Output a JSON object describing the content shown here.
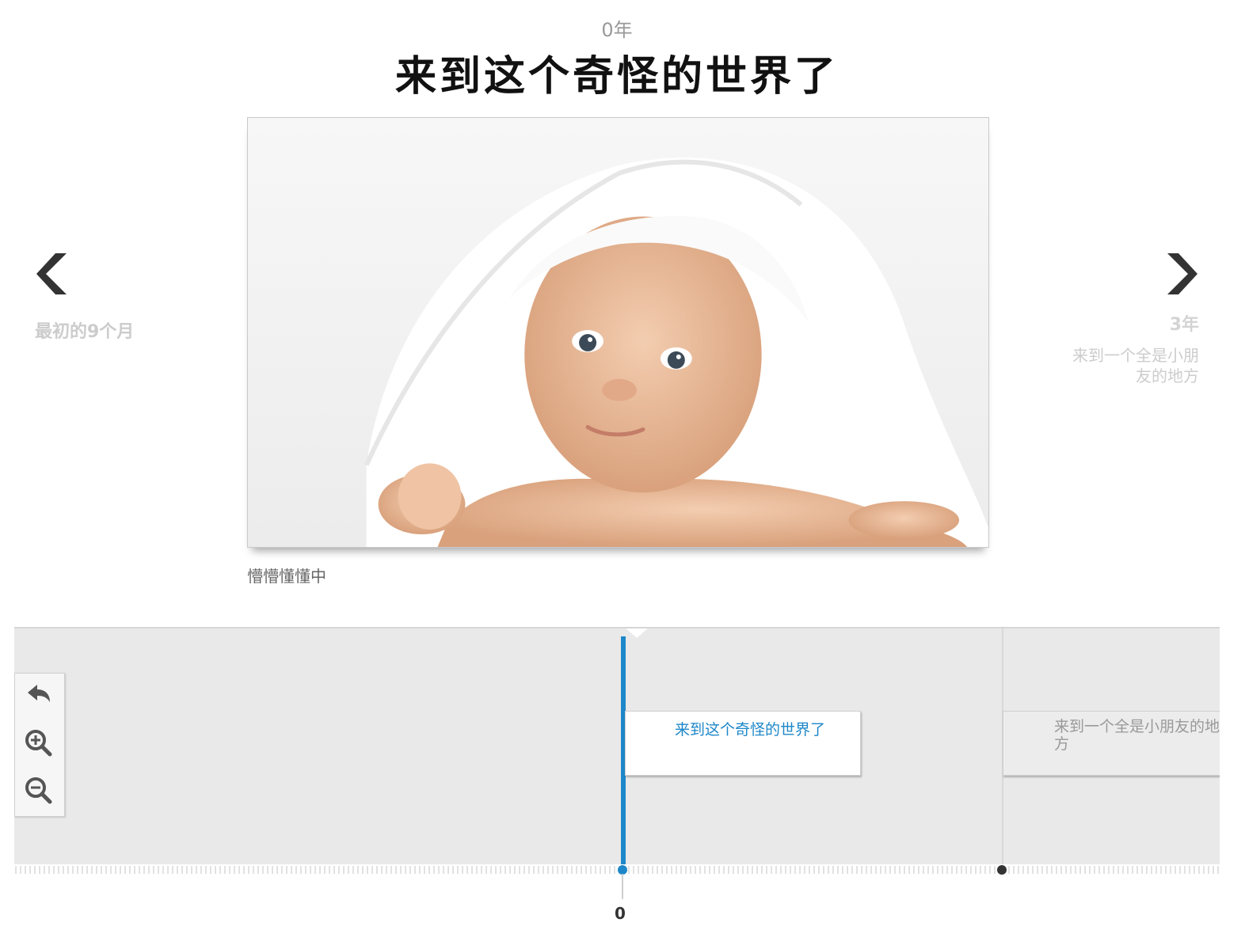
{
  "slide": {
    "year": "0年",
    "title": "来到这个奇怪的世界了",
    "caption": "懵懵懂懂中",
    "media_subject": "baby under white towel photo"
  },
  "nav": {
    "prev": {
      "title": "最初的9个月",
      "icon": "chevron-left-icon"
    },
    "next": {
      "date": "3年",
      "title": "来到一个全是小朋友的地方",
      "icon": "chevron-right-icon"
    }
  },
  "timeline": {
    "events": [
      {
        "label": "来到这个奇怪的世界了",
        "active": true
      },
      {
        "label": "来到一个全是小朋友的地方",
        "active": false
      }
    ],
    "axis_label": "0",
    "controls": [
      "back-icon",
      "zoom-in-icon",
      "zoom-out-icon"
    ],
    "accent_color": "#1d87c9"
  }
}
